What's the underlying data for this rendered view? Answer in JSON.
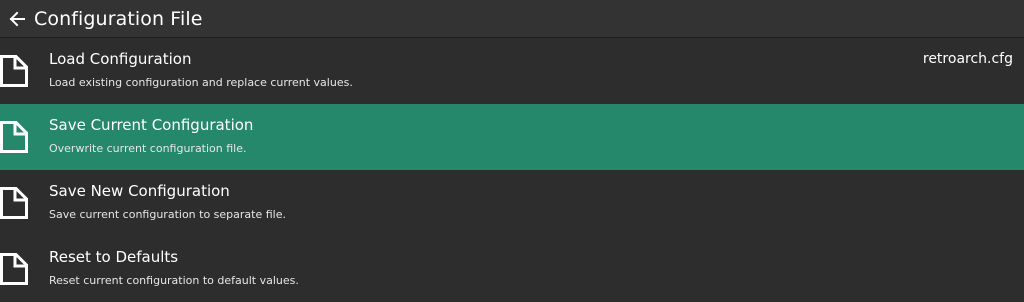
{
  "header": {
    "title": "Configuration File",
    "back_icon": "arrow-left-icon"
  },
  "colors": {
    "background": "#2d2d2d",
    "header": "#333333",
    "selected": "#26886b"
  },
  "items": [
    {
      "label": "Load Configuration",
      "sublabel": "Load existing configuration and replace current values.",
      "value": "retroarch.cfg",
      "icon": "file-icon",
      "selected": false
    },
    {
      "label": "Save Current Configuration",
      "sublabel": "Overwrite current configuration file.",
      "value": "",
      "icon": "file-icon",
      "selected": true
    },
    {
      "label": "Save New Configuration",
      "sublabel": "Save current configuration to separate file.",
      "value": "",
      "icon": "file-icon",
      "selected": false
    },
    {
      "label": "Reset to Defaults",
      "sublabel": "Reset current configuration to default values.",
      "value": "",
      "icon": "file-icon",
      "selected": false
    }
  ]
}
